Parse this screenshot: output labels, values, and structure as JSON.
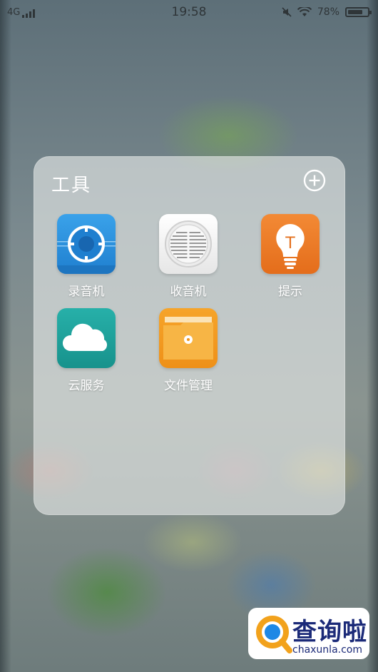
{
  "status_bar": {
    "network": "4G",
    "time": "19:58",
    "battery": "78%",
    "battery_level": 0.78,
    "icons": [
      "signal-icon",
      "mute-icon",
      "wifi-icon",
      "battery-icon"
    ]
  },
  "folder": {
    "title": "工具",
    "add_icon": "plus-circle-icon",
    "apps": [
      {
        "label": "录音机",
        "icon": "recorder-icon",
        "color": "#2b8fdc"
      },
      {
        "label": "收音机",
        "icon": "radio-icon",
        "color": "#f4f4f4"
      },
      {
        "label": "提示",
        "icon": "lightbulb-icon",
        "color": "#ee7a25"
      },
      {
        "label": "云服务",
        "icon": "cloud-icon",
        "color": "#1f9e9a"
      },
      {
        "label": "文件管理",
        "icon": "folder-icon",
        "color": "#f29b1f"
      }
    ]
  },
  "watermark": {
    "title": "查询啦",
    "url": "chaxunla.com"
  }
}
